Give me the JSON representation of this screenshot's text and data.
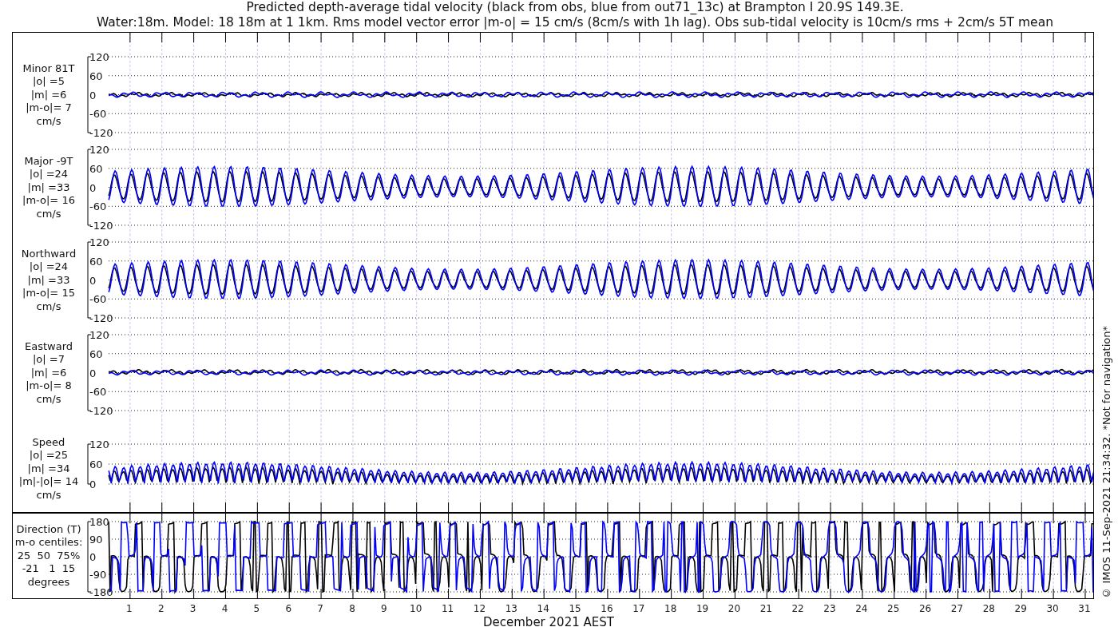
{
  "title_lines": [
    "Predicted depth-average tidal velocity (black from obs, blue from out71_13c) at Brampton I 20.9S 149.3E.",
    "Water:18m. Model: 18 18m at 1 1km. Rms model vector error |m-o| = 15 cm/s (8cm/s with 1h lag). Obs sub-tidal velocity is 10cm/s rms + 2cm/s 5T mean"
  ],
  "panels": [
    {
      "kind": "minor",
      "label_lines": [
        "Minor 81T",
        "|o| =5",
        "|m| =6",
        "|m-o|= 7",
        "cm/s"
      ],
      "yticks": [
        "120",
        "60",
        "0",
        "-60",
        "-120"
      ]
    },
    {
      "kind": "major",
      "label_lines": [
        "Major -9T",
        "|o| =24",
        "|m| =33",
        "|m-o|= 16",
        "cm/s"
      ],
      "yticks": [
        "120",
        "60",
        "0",
        "-60",
        "-120"
      ]
    },
    {
      "kind": "north",
      "label_lines": [
        "Northward",
        "|o| =24",
        "|m| =33",
        "|m-o|= 15",
        "cm/s"
      ],
      "yticks": [
        "120",
        "60",
        "0",
        "-60",
        "-120"
      ]
    },
    {
      "kind": "east",
      "label_lines": [
        "Eastward",
        "|o| =7",
        "|m| =6",
        "|m-o|= 8",
        "cm/s"
      ],
      "yticks": [
        "120",
        "60",
        "0",
        "-60",
        "-120"
      ]
    },
    {
      "kind": "speed",
      "label_lines": [
        "Speed",
        "|o| =25",
        "|m| =34",
        "|m|-|o|= 14",
        "cm/s"
      ],
      "yticks": [
        "120",
        "60",
        "0"
      ]
    },
    {
      "kind": "direction",
      "label_lines": [
        "Direction (T)",
        "m-o centiles:",
        "25  50  75%",
        "-21   1  15",
        "degrees"
      ],
      "yticks": [
        "180",
        "90",
        "0",
        "-90",
        "-180"
      ]
    }
  ],
  "xticks": [
    "1",
    "2",
    "3",
    "4",
    "5",
    "6",
    "7",
    "8",
    "9",
    "10",
    "11",
    "12",
    "13",
    "14",
    "15",
    "16",
    "17",
    "18",
    "19",
    "20",
    "21",
    "22",
    "23",
    "24",
    "25",
    "26",
    "27",
    "28",
    "29",
    "30",
    "31"
  ],
  "xlabel": "December 2021 AEST",
  "side_note": "© IMOS 11-Sep-2021 21:34:32. *Not for navigation*"
}
